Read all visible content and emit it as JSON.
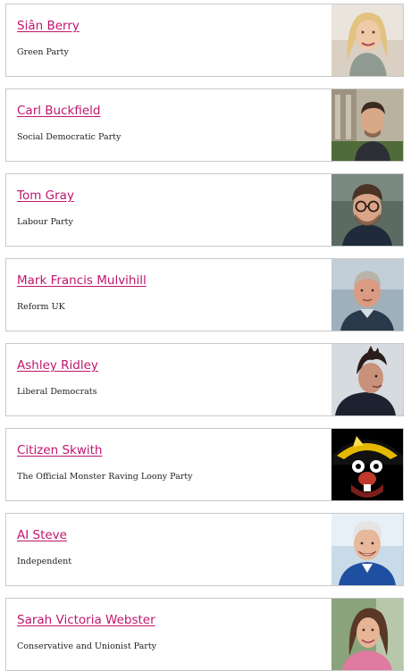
{
  "candidates": [
    {
      "name": "Siân Berry",
      "party": "Green Party",
      "photo_alt": "photo of Siân Berry"
    },
    {
      "name": "Carl Buckfield",
      "party": "Social Democratic Party",
      "photo_alt": "photo of Carl Buckfield"
    },
    {
      "name": "Tom Gray",
      "party": "Labour Party",
      "photo_alt": "photo of Tom Gray"
    },
    {
      "name": "Mark Francis Mulvihill",
      "party": "Reform UK",
      "photo_alt": "photo of Mark Francis Mulvihill"
    },
    {
      "name": "Ashley Ridley",
      "party": "Liberal Democrats",
      "photo_alt": "photo of Ashley Ridley"
    },
    {
      "name": "Citizen Skwith",
      "party": "The Official Monster Raving Loony Party",
      "photo_alt": "photo of Citizen Skwith"
    },
    {
      "name": "AI Steve",
      "party": "Independent",
      "photo_alt": "photo of AI Steve"
    },
    {
      "name": "Sarah Victoria Webster",
      "party": "Conservative and Unionist Party",
      "photo_alt": "photo of Sarah Victoria Webster"
    }
  ],
  "colors": {
    "link": "#c0156e",
    "border": "#c9c9c9",
    "text": "#222222"
  }
}
